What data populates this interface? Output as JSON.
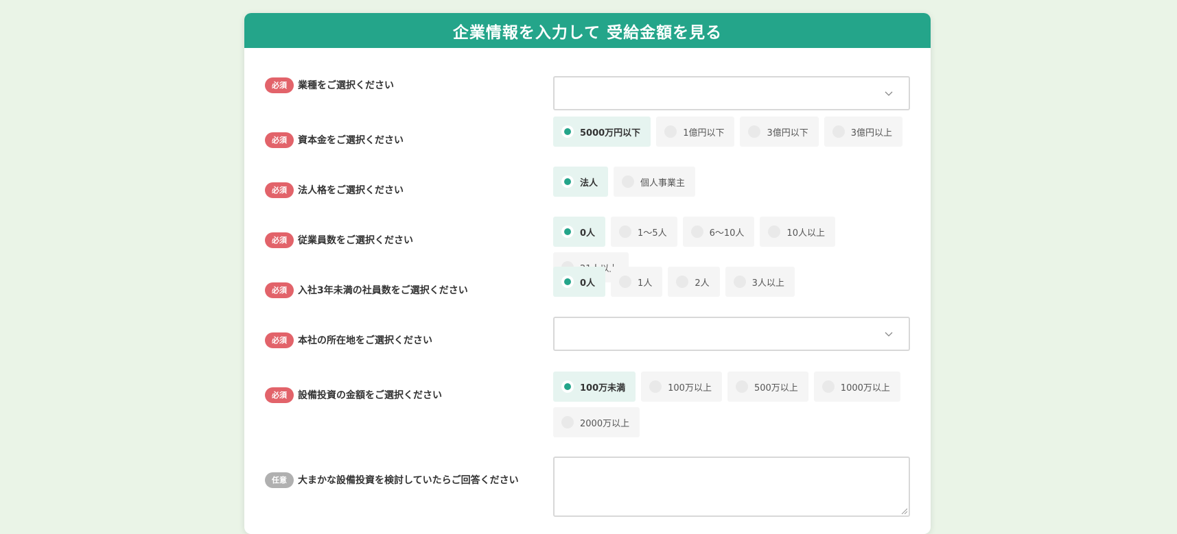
{
  "form": {
    "title": "企業情報を入力して 受給金額を見る",
    "required_label": "必須",
    "optional_label": "任意",
    "fields": [
      {
        "label": "業種をご選択ください",
        "type": "select",
        "value": ""
      },
      {
        "label": "資本金をご選択ください",
        "type": "radio",
        "options": [
          "5000万円以下",
          "1億円以下",
          "3億円以下",
          "3億円以上"
        ],
        "selected": 0
      },
      {
        "label": "法人格をご選択ください",
        "type": "radio",
        "options": [
          "法人",
          "個人事業主"
        ],
        "selected": 0
      },
      {
        "label": "従業員数をご選択ください",
        "type": "radio",
        "options": [
          "0人",
          "1～5人",
          "6～10人",
          "10人以上",
          "21人以上"
        ],
        "selected": 0
      },
      {
        "label": "入社3年未満の社員数をご選択ください",
        "type": "radio",
        "options": [
          "0人",
          "1人",
          "2人",
          "3人以上"
        ],
        "selected": 0
      },
      {
        "label": "本社の所在地をご選択ください",
        "type": "select",
        "value": ""
      },
      {
        "label": "設備投資の金額をご選択ください",
        "type": "radio",
        "options": [
          "100万未満",
          "100万以上",
          "500万以上",
          "1000万以上",
          "2000万以上"
        ],
        "selected": 0
      },
      {
        "label": "大まかな設備投資を検討していたらご回答ください",
        "type": "textarea",
        "value": ""
      }
    ]
  },
  "icons": {
    "select_arrow": "chevron-down-icon",
    "resize": "resize-handle-icon"
  },
  "colors": {
    "primary": "#24a58a",
    "required_badge": "#e2636a",
    "optional_badge": "#b0b0b0",
    "background": "#eaf4e7"
  }
}
